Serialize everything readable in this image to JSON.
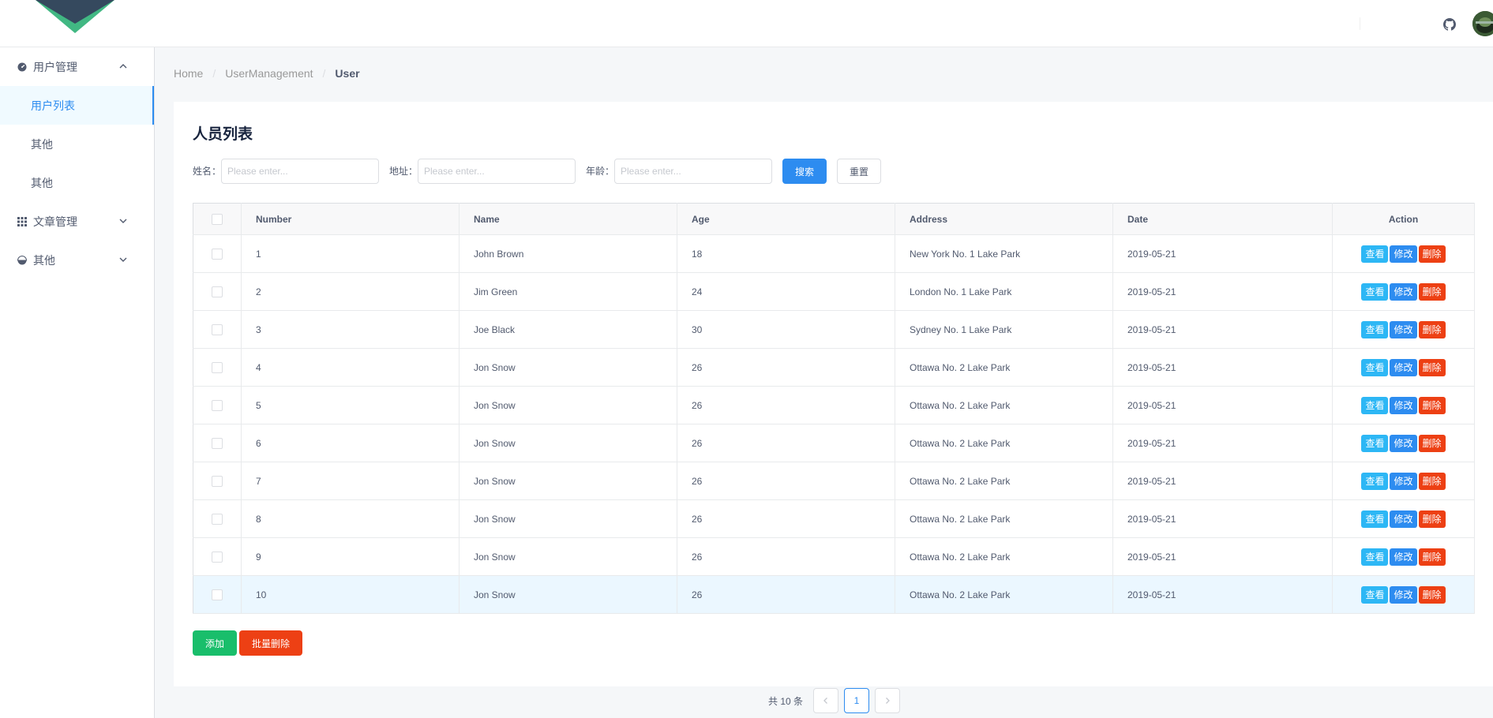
{
  "header": {
    "brand_colors": {
      "dark": "#35495e",
      "green": "#41b883"
    },
    "github_icon": "github-icon",
    "avatar_icon": "user-avatar"
  },
  "sidebar": {
    "groups": [
      {
        "label": "用户管理",
        "icon": "dashboard-icon",
        "expanded": true,
        "items": [
          {
            "label": "用户列表",
            "active": true
          },
          {
            "label": "其他",
            "active": false
          },
          {
            "label": "其他",
            "active": false
          }
        ]
      },
      {
        "label": "文章管理",
        "icon": "grid-icon",
        "expanded": false
      },
      {
        "label": "其他",
        "icon": "pie-icon",
        "expanded": false
      }
    ]
  },
  "breadcrumb": [
    "Home",
    "UserManagement",
    "User"
  ],
  "page_title": "人员列表",
  "filters": {
    "name_label": "姓名：",
    "address_label": "地址：",
    "age_label": "年龄：",
    "placeholder": "Please enter...",
    "search_label": "搜索",
    "reset_label": "重置"
  },
  "table": {
    "columns": [
      "Number",
      "Name",
      "Age",
      "Address",
      "Date",
      "Action"
    ],
    "action_labels": {
      "view": "查看",
      "edit": "修改",
      "delete": "删除"
    },
    "rows": [
      {
        "number": "1",
        "name": "John Brown",
        "age": "18",
        "address": "New York No. 1 Lake Park",
        "date": "2019-05-21"
      },
      {
        "number": "2",
        "name": "Jim Green",
        "age": "24",
        "address": "London No. 1 Lake Park",
        "date": "2019-05-21"
      },
      {
        "number": "3",
        "name": "Joe Black",
        "age": "30",
        "address": "Sydney No. 1 Lake Park",
        "date": "2019-05-21"
      },
      {
        "number": "4",
        "name": "Jon Snow",
        "age": "26",
        "address": "Ottawa No. 2 Lake Park",
        "date": "2019-05-21"
      },
      {
        "number": "5",
        "name": "Jon Snow",
        "age": "26",
        "address": "Ottawa No. 2 Lake Park",
        "date": "2019-05-21"
      },
      {
        "number": "6",
        "name": "Jon Snow",
        "age": "26",
        "address": "Ottawa No. 2 Lake Park",
        "date": "2019-05-21"
      },
      {
        "number": "7",
        "name": "Jon Snow",
        "age": "26",
        "address": "Ottawa No. 2 Lake Park",
        "date": "2019-05-21"
      },
      {
        "number": "8",
        "name": "Jon Snow",
        "age": "26",
        "address": "Ottawa No. 2 Lake Park",
        "date": "2019-05-21"
      },
      {
        "number": "9",
        "name": "Jon Snow",
        "age": "26",
        "address": "Ottawa No. 2 Lake Park",
        "date": "2019-05-21"
      },
      {
        "number": "10",
        "name": "Jon Snow",
        "age": "26",
        "address": "Ottawa No. 2 Lake Park",
        "date": "2019-05-21"
      }
    ]
  },
  "bottom_actions": {
    "add_label": "添加",
    "batch_delete_label": "批量删除"
  },
  "pagination": {
    "total_text": "共 10 条",
    "current_page": "1",
    "prev_icon": "chevron-left-icon",
    "next_icon": "chevron-right-icon"
  }
}
